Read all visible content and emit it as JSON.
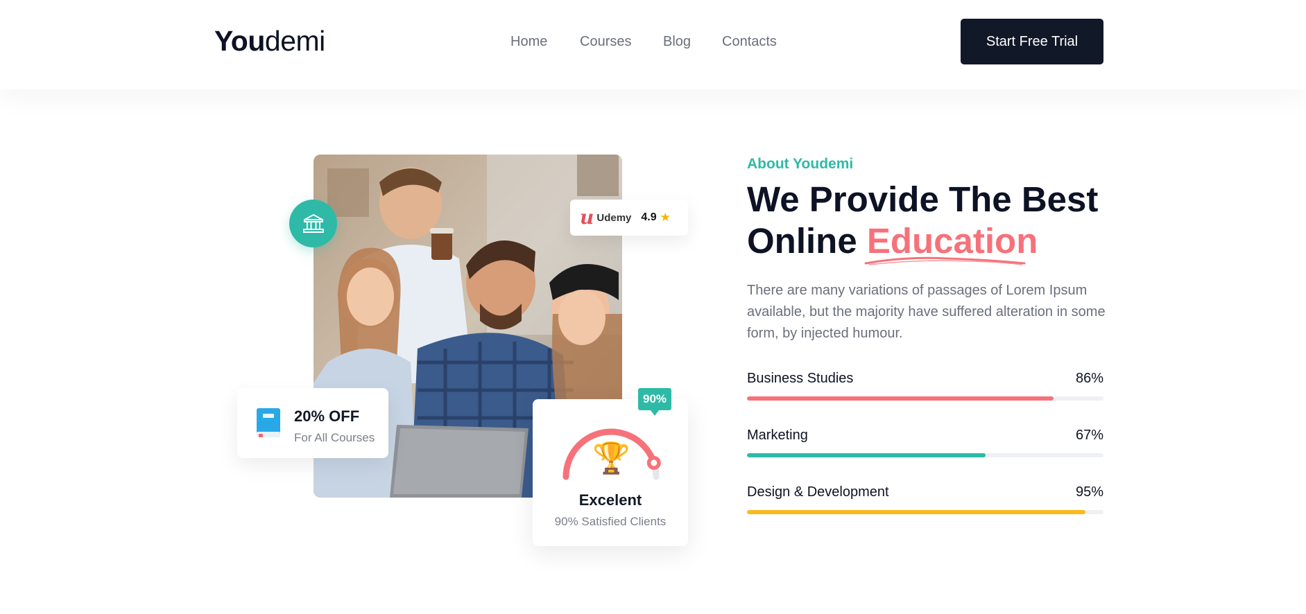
{
  "header": {
    "logo_bold": "You",
    "logo_light": "demi",
    "nav": [
      "Home",
      "Courses",
      "Blog",
      "Contacts"
    ],
    "cta_label": "Start Free Trial"
  },
  "rating": {
    "brand": "Udemy",
    "score": "4.9",
    "star_icon": "star-icon"
  },
  "offer": {
    "title": "20% OFF",
    "subtitle": "For All Courses",
    "icon": "book-icon"
  },
  "excellence": {
    "tag": "90%",
    "title": "Excelent",
    "subtitle": "90% Satisfied Clients",
    "gauge_fraction": 0.9,
    "icon": "trophy-icon"
  },
  "about": {
    "eyebrow": "About Youdemi",
    "headline_line1": "We Provide The Best",
    "headline_line2_prefix": "Online ",
    "headline_highlight": "Education",
    "description": "There are many variations of passages of Lorem Ipsum available, but the majority have suffered alteration in some form, by injected humour."
  },
  "skills": [
    {
      "label": "Business Studies",
      "value_text": "86%",
      "value": 86,
      "color": "#f6727a"
    },
    {
      "label": "Marketing",
      "value_text": "67%",
      "value": 67,
      "color": "#2ebaa6"
    },
    {
      "label": "Design & Development",
      "value_text": "95%",
      "value": 95,
      "color": "#fbb91c"
    }
  ],
  "colors": {
    "teal": "#2ebaa6",
    "coral": "#f6727a",
    "yellow": "#fbb91c",
    "navy": "#111827"
  }
}
